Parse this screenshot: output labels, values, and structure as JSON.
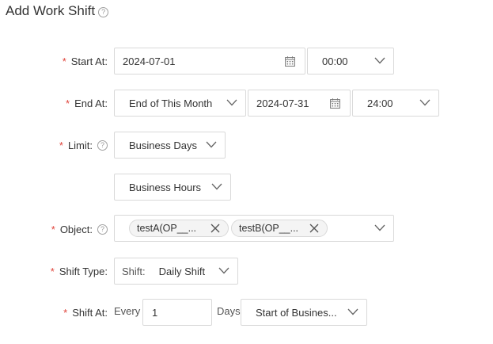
{
  "page": {
    "title": "Add Work Shift",
    "help_glyph": "?"
  },
  "required_mark": "*",
  "fields": {
    "start_at": {
      "label": "Start At:",
      "date": "2024-07-01",
      "time": "00:00"
    },
    "end_at": {
      "label": "End At:",
      "mode": "End of This Month",
      "date": "2024-07-31",
      "time": "24:00"
    },
    "limit": {
      "label": "Limit:",
      "option1": "Business Days",
      "option2": "Business Hours"
    },
    "object": {
      "label": "Object:",
      "tags": [
        "testA(OP__...",
        "testB(OP__..."
      ]
    },
    "shift_type": {
      "label": "Shift Type:",
      "prefix": "Shift:",
      "value": "Daily Shift"
    },
    "shift_at": {
      "label": "Shift At:",
      "every": "Every",
      "count": "1",
      "unit": "Days",
      "start": "Start of Busines..."
    }
  },
  "icons": {
    "help": "question-circle-icon",
    "chevron": "chevron-down-icon",
    "calendar": "calendar-icon",
    "close": "close-icon"
  },
  "colors": {
    "required": "#e0433a",
    "border": "#d9d9d9",
    "text": "#333333",
    "muted": "#999999"
  }
}
